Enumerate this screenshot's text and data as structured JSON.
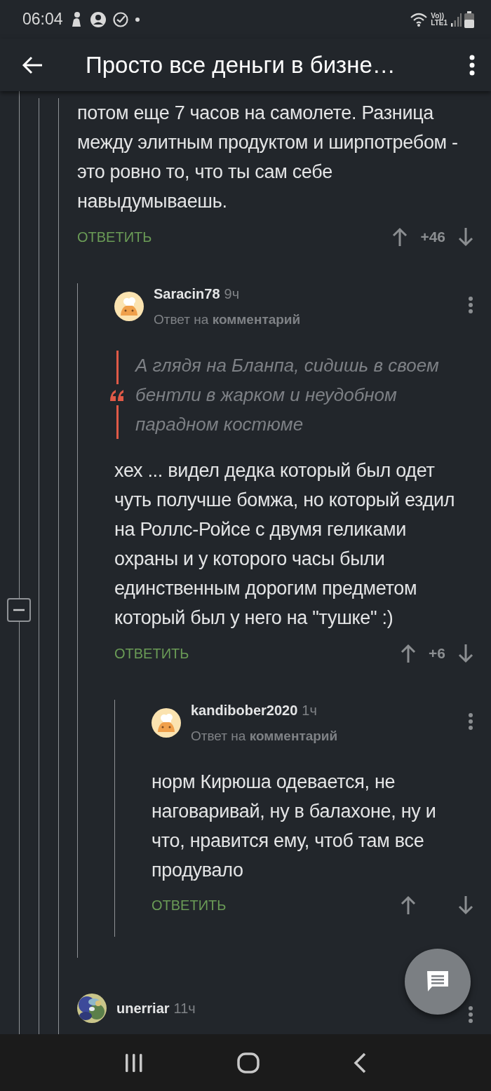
{
  "status_bar": {
    "time": "06:04",
    "volte_label": "Vo))",
    "network_label": "LTE1"
  },
  "app_bar": {
    "title": "Просто все деньги в бизне…"
  },
  "comments": [
    {
      "text": "потом еще 7 часов на самолете. Разница между элитным продуктом и ширпотребом - это ровно то, что ты сам себе навыдумываешь.",
      "reply_label": "ОТВЕТИТЬ",
      "score": "+46",
      "children": [
        {
          "author": "Saracin78",
          "time": "9ч",
          "reply_to": "Ответ на **комментарий**",
          "kind": "chef",
          "expanded": true,
          "quote": "А глядя на Бланпа, сидишь в своем бентли в жарком и неудобном парадном костюме",
          "text": "хех ... видел дедка который был одет чуть получше бомжа, но который ездил на Роллс-Ройсе с двумя геликами охраны и у которого часы были единственным дорогим предметом который был у него на \"тушке\" :)",
          "reply_label": "ОТВЕТИТЬ",
          "score": "+6",
          "children": [
            {
              "author": "kandibober2020",
              "time": "1ч",
              "reply_to": "Ответ на **комментарий**",
              "kind": "chef",
              "text": "норм Кирюша одевается, не наговаривай, ну в балахоне, ну и что, нравится ему, чтоб там все продувало",
              "reply_label": "ОТВЕТИТЬ"
            }
          ]
        }
      ]
    },
    {
      "author": "unerriar",
      "time": "11ч"
    }
  ]
}
